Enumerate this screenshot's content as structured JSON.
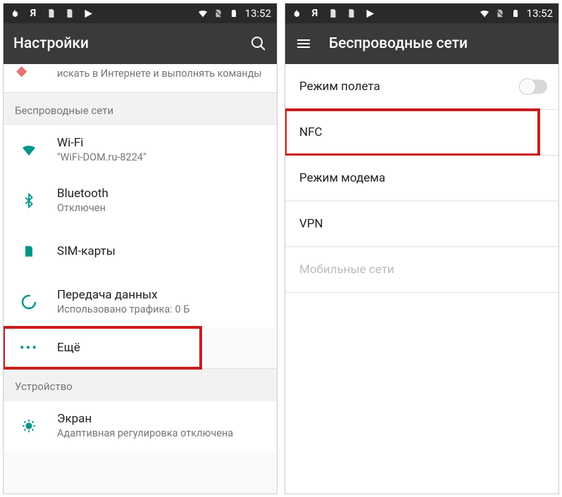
{
  "statusbar": {
    "time": "13:52",
    "icons_left": [
      "flame-icon",
      "letter-ya",
      "doc1-icon",
      "doc2-icon",
      "play-icon"
    ],
    "icons_right": [
      "wifi-icon",
      "sim-off-icon",
      "battery-icon"
    ]
  },
  "left": {
    "title": "Настройки",
    "partial_row_sub": "искать в Интернете и выполнять команды",
    "section1": "Беспроводные сети",
    "items": [
      {
        "icon": "wifi",
        "title": "Wi-Fi",
        "sub": "\"WiFi-DOM.ru-8224\""
      },
      {
        "icon": "bluetooth",
        "title": "Bluetooth",
        "sub": "Отключен"
      },
      {
        "icon": "sim",
        "title": "SIM-карты",
        "sub": ""
      },
      {
        "icon": "data",
        "title": "Передача данных",
        "sub": "Использовано трафика: 0 Б"
      },
      {
        "icon": "more",
        "title": "Ещё",
        "sub": "",
        "highlight": true
      }
    ],
    "section2": "Устройство",
    "items2": [
      {
        "icon": "display",
        "title": "Экран",
        "sub": "Адаптивная регулировка отключена"
      }
    ]
  },
  "right": {
    "title": "Беспроводные сети",
    "items": [
      {
        "title": "Режим полета",
        "toggle": true
      },
      {
        "title": "NFC",
        "highlight": true
      },
      {
        "title": "Режим модема"
      },
      {
        "title": "VPN"
      },
      {
        "title": "Мобильные сети",
        "disabled": true
      }
    ]
  },
  "letter_ya": "Я"
}
